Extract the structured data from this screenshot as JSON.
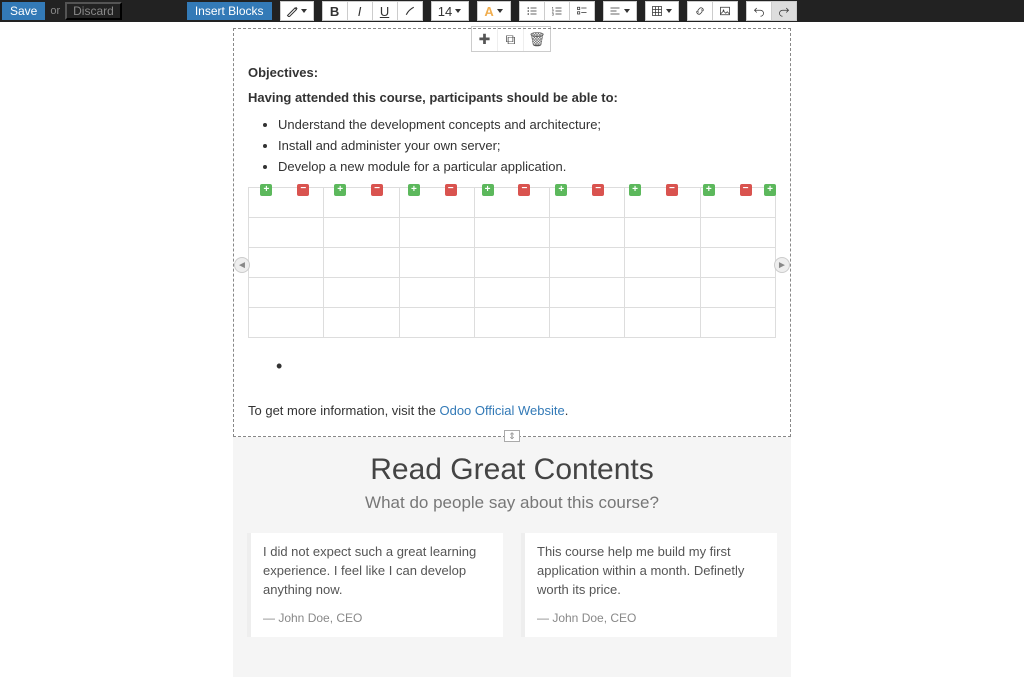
{
  "topbar": {
    "save": "Save",
    "or": "or",
    "discard": "Discard",
    "insert_blocks": "Insert Blocks",
    "fontsize": "14"
  },
  "content": {
    "objectives_title": "Objectives:",
    "objectives_subtitle": "Having attended this course, participants should be able to:",
    "items": [
      "Understand the development concepts and architecture;",
      "Install and administer your own server;",
      "Develop a new module for a particular application."
    ],
    "footer_prefix": "To get more information, visit the ",
    "footer_link": "Odoo Official Website",
    "footer_suffix": "."
  },
  "read": {
    "title": "Read Great Contents",
    "subtitle": "What do people say about this course?",
    "quotes": [
      {
        "text": "I did not expect such a great learning experience. I feel like I can develop anything now.",
        "author": "— John Doe, CEO"
      },
      {
        "text": "This course help me build my first application within a month. Definetly worth its price.",
        "author": "— John Doe, CEO"
      }
    ]
  }
}
